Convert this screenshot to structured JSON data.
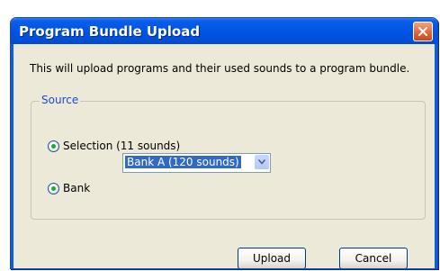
{
  "dialog": {
    "title": "Program Bundle Upload",
    "description": "This will upload programs and their used sounds to a program bundle."
  },
  "source": {
    "legend": "Source",
    "selection_label": "Selection (11 sounds)",
    "bank_label": "Bank",
    "bank_select_value": "Bank A (120 sounds)"
  },
  "buttons": {
    "upload": "Upload",
    "cancel": "Cancel"
  },
  "icons": {
    "close": "close-icon",
    "dropdown": "chevron-down-icon"
  },
  "colors": {
    "titlebar": "#0055e4",
    "close_button": "#e06a39",
    "dialog_background": "#ece9d8",
    "legend_text": "#1f48c8",
    "selection_highlight": "#316ac5"
  }
}
